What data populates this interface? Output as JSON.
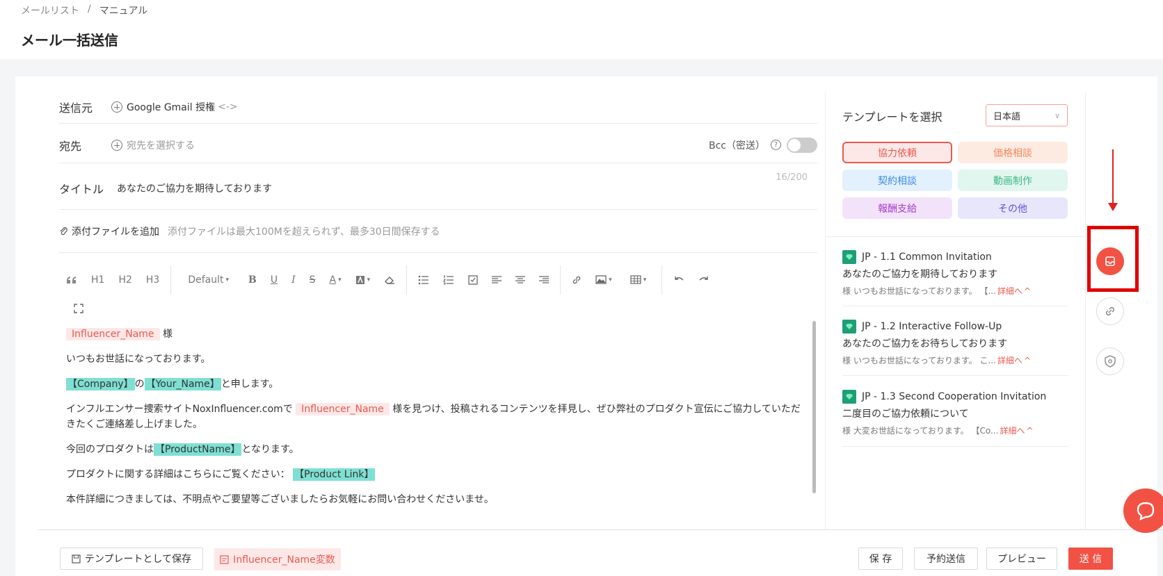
{
  "breadcrumb": {
    "parent": "メールリスト",
    "separator": "/",
    "current": "マニュアル"
  },
  "page_title": "メール一括送信",
  "compose": {
    "sender_label": "送信元",
    "sender_button": "Google Gmail 授権",
    "sender_arrows": "<->",
    "recipient_label": "宛先",
    "recipient_placeholder": "宛先を選択する",
    "bcc_label": "Bcc（密送）",
    "title_label": "タイトル",
    "title_value": "あなたのご協力を期待しております",
    "title_count": "16/200",
    "attach_button": "添付ファイルを追加",
    "attach_hint": "添付ファイルは最大100Mを超えられず、最多30日間保存する"
  },
  "toolbar": {
    "h1": "H1",
    "h2": "H2",
    "h3": "H3",
    "font_size": "Default"
  },
  "editor": {
    "var_influencer": "Influencer_Name",
    "honorific": "様",
    "line1": "いつもお世話になっております。",
    "var_company": "【Company】",
    "no": "の",
    "var_your_name": "【Your_Name】",
    "line2_suffix": "と申します。",
    "line3_prefix": "インフルエンサー捜索サイトNoxInfluencer.comで",
    "line3_suffix": "様を見つけ、投稿されるコンテンツを拝見し、ぜひ弊社のプロダクト宣伝にご協力していただきたくご連絡差し上げました。",
    "line4_prefix": "今回のプロダクトは",
    "var_product_name": "【ProductName】",
    "line4_suffix": "となります。",
    "line5_prefix": "プロダクトに関する詳細はこちらにご覧ください：",
    "var_product_link": "【Product Link】",
    "line6": "本件詳細につきましては、不明点やご要望等ございましたらお気軽にお問い合わせくださいませ。"
  },
  "bottom": {
    "save_template": "テンプレートとして保存",
    "insert_variable": "Influencer_Name変数",
    "save": "保 存",
    "schedule": "予約送信",
    "preview": "プレビュー",
    "send": "送 信"
  },
  "templates": {
    "title": "テンプレートを選択",
    "language": "日本語",
    "categories": [
      "協力依頼",
      "価格相談",
      "契約相談",
      "動画制作",
      "報酬支給",
      "その他"
    ],
    "items": [
      {
        "name": "JP - 1.1 Common Invitation",
        "subject": "あなたのご協力を期待しております",
        "preview": "様 いつもお世話になっております。 【...",
        "detail": "詳細へ"
      },
      {
        "name": "JP - 1.2 Interactive Follow-Up",
        "subject": "あなたのご協力をお待ちしております",
        "preview": "様 いつもお世話になっております。 こ...",
        "detail": "詳細へ"
      },
      {
        "name": "JP - 1.3 Second Cooperation Invitation",
        "subject": "二度目のご協力依頼について",
        "preview": "様 大変お世話になっております。 【Co...",
        "detail": "詳細へ"
      }
    ]
  },
  "colors": {
    "accent": "#f25244",
    "variable_red": "#e85a4f",
    "variable_teal": "#7ee0d3"
  },
  "icons": [
    "plus-circle-icon",
    "help-icon",
    "paperclip-icon",
    "quote-icon",
    "bold-icon",
    "underline-icon",
    "italic-icon",
    "strikethrough-icon",
    "font-color-icon",
    "background-color-icon",
    "eraser-icon",
    "bullet-list-icon",
    "numbered-list-icon",
    "checklist-icon",
    "align-left-icon",
    "align-center-icon",
    "align-right-icon",
    "link-icon",
    "image-icon",
    "table-icon",
    "undo-icon",
    "redo-icon",
    "fullscreen-icon",
    "inbox-icon",
    "chat-icon"
  ]
}
